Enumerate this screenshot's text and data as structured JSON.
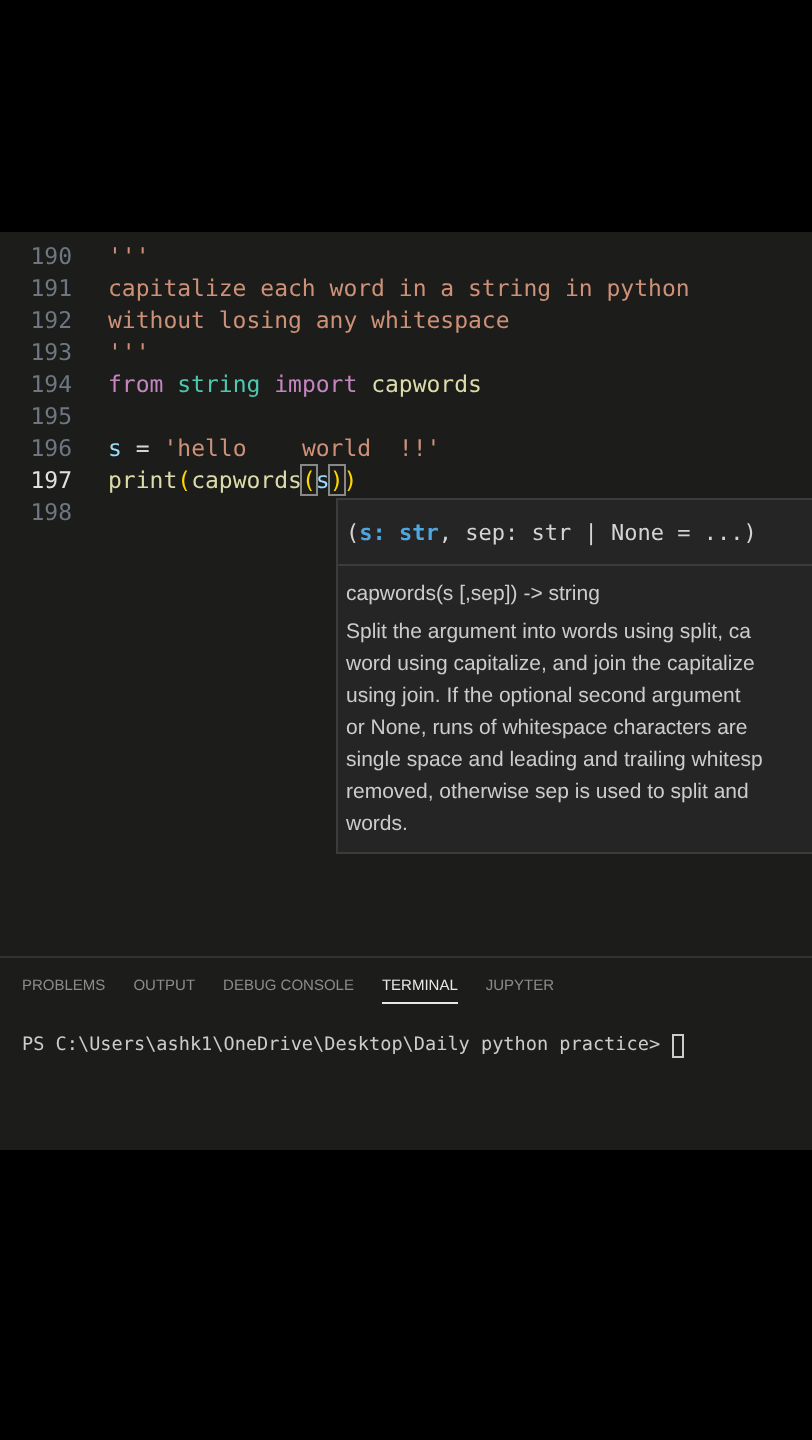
{
  "editor": {
    "lines": [
      {
        "number": "190",
        "current": false,
        "tokens": [
          {
            "text": "'''",
            "kind": "string"
          }
        ]
      },
      {
        "number": "191",
        "current": false,
        "tokens": [
          {
            "text": "capitalize each word in a string in python",
            "kind": "string"
          }
        ]
      },
      {
        "number": "192",
        "current": false,
        "tokens": [
          {
            "text": "without losing any whitespace",
            "kind": "string"
          }
        ]
      },
      {
        "number": "193",
        "current": false,
        "tokens": [
          {
            "text": "'''",
            "kind": "string"
          }
        ]
      },
      {
        "number": "194",
        "current": false,
        "tokens": [
          {
            "text": "from ",
            "kind": "keyword"
          },
          {
            "text": "string ",
            "kind": "module"
          },
          {
            "text": "import ",
            "kind": "keyword"
          },
          {
            "text": "capwords",
            "kind": "function"
          }
        ]
      },
      {
        "number": "195",
        "current": false
      },
      {
        "number": "196",
        "current": false,
        "tokens": [
          {
            "text": "s",
            "kind": "variable"
          },
          {
            "text": " = ",
            "kind": "plain"
          },
          {
            "text": "'hello    world  !!'",
            "kind": "string"
          }
        ]
      },
      {
        "number": "197",
        "current": true,
        "tokens": [
          {
            "text": "print",
            "kind": "function"
          },
          {
            "text": "(",
            "kind": "bracket"
          },
          {
            "text": "capwords",
            "kind": "function"
          },
          {
            "text": "(",
            "kind": "match"
          },
          {
            "text": "s",
            "kind": "variable"
          },
          {
            "text": ")",
            "kind": "match"
          },
          {
            "text": ")",
            "kind": "bracket"
          }
        ]
      },
      {
        "number": "198",
        "current": false
      }
    ]
  },
  "hover": {
    "signature": [
      {
        "text": "(",
        "kind": "plain"
      },
      {
        "text": "s: str",
        "kind": "param"
      },
      {
        "text": ", sep: str | None = ...)",
        "kind": "plain"
      }
    ],
    "doc_title": "capwords(s [,sep]) -> string",
    "doc_lines": [
      "Split the argument into words using split, ca",
      "word using capitalize, and join the capitalize",
      "using join. If the optional second argument",
      "or None, runs of whitespace characters are",
      "single space and leading and trailing whitesp",
      "removed, otherwise sep is used to split and",
      "words."
    ]
  },
  "panel": {
    "tabs": [
      {
        "label": "PROBLEMS",
        "selected": false
      },
      {
        "label": "OUTPUT",
        "selected": false
      },
      {
        "label": "DEBUG CONSOLE",
        "selected": false
      },
      {
        "label": "TERMINAL",
        "selected": true
      },
      {
        "label": "JUPYTER",
        "selected": false
      }
    ],
    "terminal_prompt": "PS C:\\Users\\ashk1\\OneDrive\\Desktop\\Daily python practice>"
  }
}
